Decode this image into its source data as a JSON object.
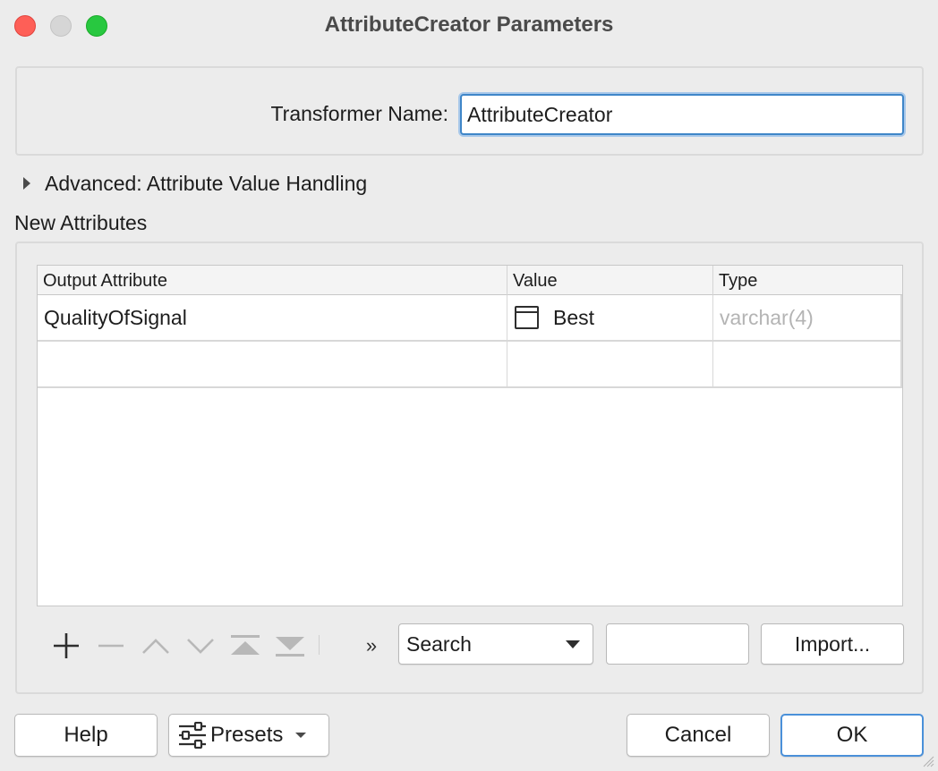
{
  "window": {
    "title": "AttributeCreator Parameters"
  },
  "name_section": {
    "label": "Transformer Name:",
    "value": "AttributeCreator"
  },
  "advanced": {
    "label": "Advanced: Attribute Value Handling"
  },
  "new_attributes": {
    "label": "New Attributes",
    "columns": [
      "Output Attribute",
      "Value",
      "Type"
    ],
    "rows": [
      {
        "output_attribute": "QualityOfSignal",
        "value": "Best",
        "type": "varchar(4)"
      },
      {
        "output_attribute": "",
        "value": "",
        "type": ""
      }
    ]
  },
  "toolbar": {
    "overflow_glyph": "»",
    "search_mode": "Search",
    "search_value": "",
    "import_label": "Import..."
  },
  "footer": {
    "help_label": "Help",
    "presets_label": "Presets",
    "cancel_label": "Cancel",
    "ok_label": "OK"
  },
  "icons": {
    "add": "plus-icon",
    "remove": "minus-icon",
    "move_up": "chevron-up-icon",
    "move_down": "chevron-down-icon",
    "move_top": "move-to-top-icon",
    "move_bottom": "move-to-bottom-icon",
    "value_type": "text-value-icon",
    "presets": "sliders-icon"
  },
  "colors": {
    "accent": "#4a90d9",
    "close": "#fe5f57",
    "minimize": "#d6d6d6",
    "maximize": "#28c840",
    "disabled_text": "#b4b4b4"
  }
}
